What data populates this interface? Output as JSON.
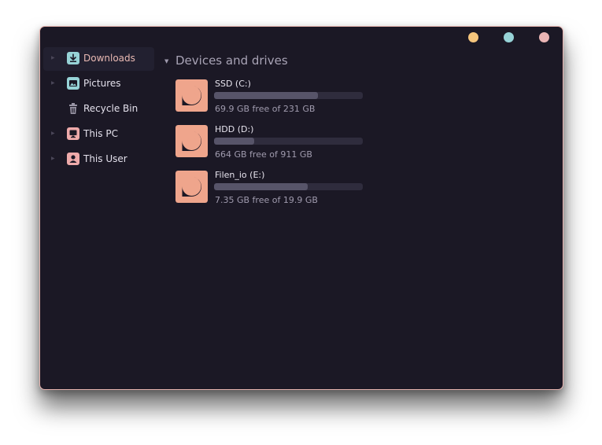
{
  "window": {
    "controls": [
      {
        "name": "minimize",
        "color": "#f5c57d"
      },
      {
        "name": "maximize",
        "color": "#97d3d7"
      },
      {
        "name": "close",
        "color": "#ebb5b5"
      }
    ],
    "border_color": "#e8b5b0",
    "background": "#1b1825"
  },
  "sidebar": {
    "items": [
      {
        "label": "Downloads",
        "icon": "downloads-icon",
        "icon_color": "#97d3d7",
        "selected": true
      },
      {
        "label": "Pictures",
        "icon": "pictures-icon",
        "icon_color": "#97d3d7",
        "selected": false
      },
      {
        "label": "Recycle Bin",
        "icon": "recycle-bin-icon",
        "icon_color": "#9a96a6",
        "selected": false
      },
      {
        "label": "This PC",
        "icon": "this-pc-icon",
        "icon_color": "#eeaaaa",
        "selected": false
      },
      {
        "label": "This User",
        "icon": "this-user-icon",
        "icon_color": "#eeaaaa",
        "selected": false
      }
    ]
  },
  "main": {
    "section_title": "Devices and drives",
    "drives": [
      {
        "name": "SSD (C:)",
        "free_text": "69.9 GB free of 231 GB",
        "used_fraction": 0.7
      },
      {
        "name": "HDD (D:)",
        "free_text": "664 GB free of 911 GB",
        "used_fraction": 0.27
      },
      {
        "name": "Filen_io (E:)",
        "free_text": "7.35 GB free of 19.9 GB",
        "used_fraction": 0.63
      }
    ],
    "drive_icon_color": "#efa58c",
    "drive_icon_glyph_color": "#1b1825"
  }
}
